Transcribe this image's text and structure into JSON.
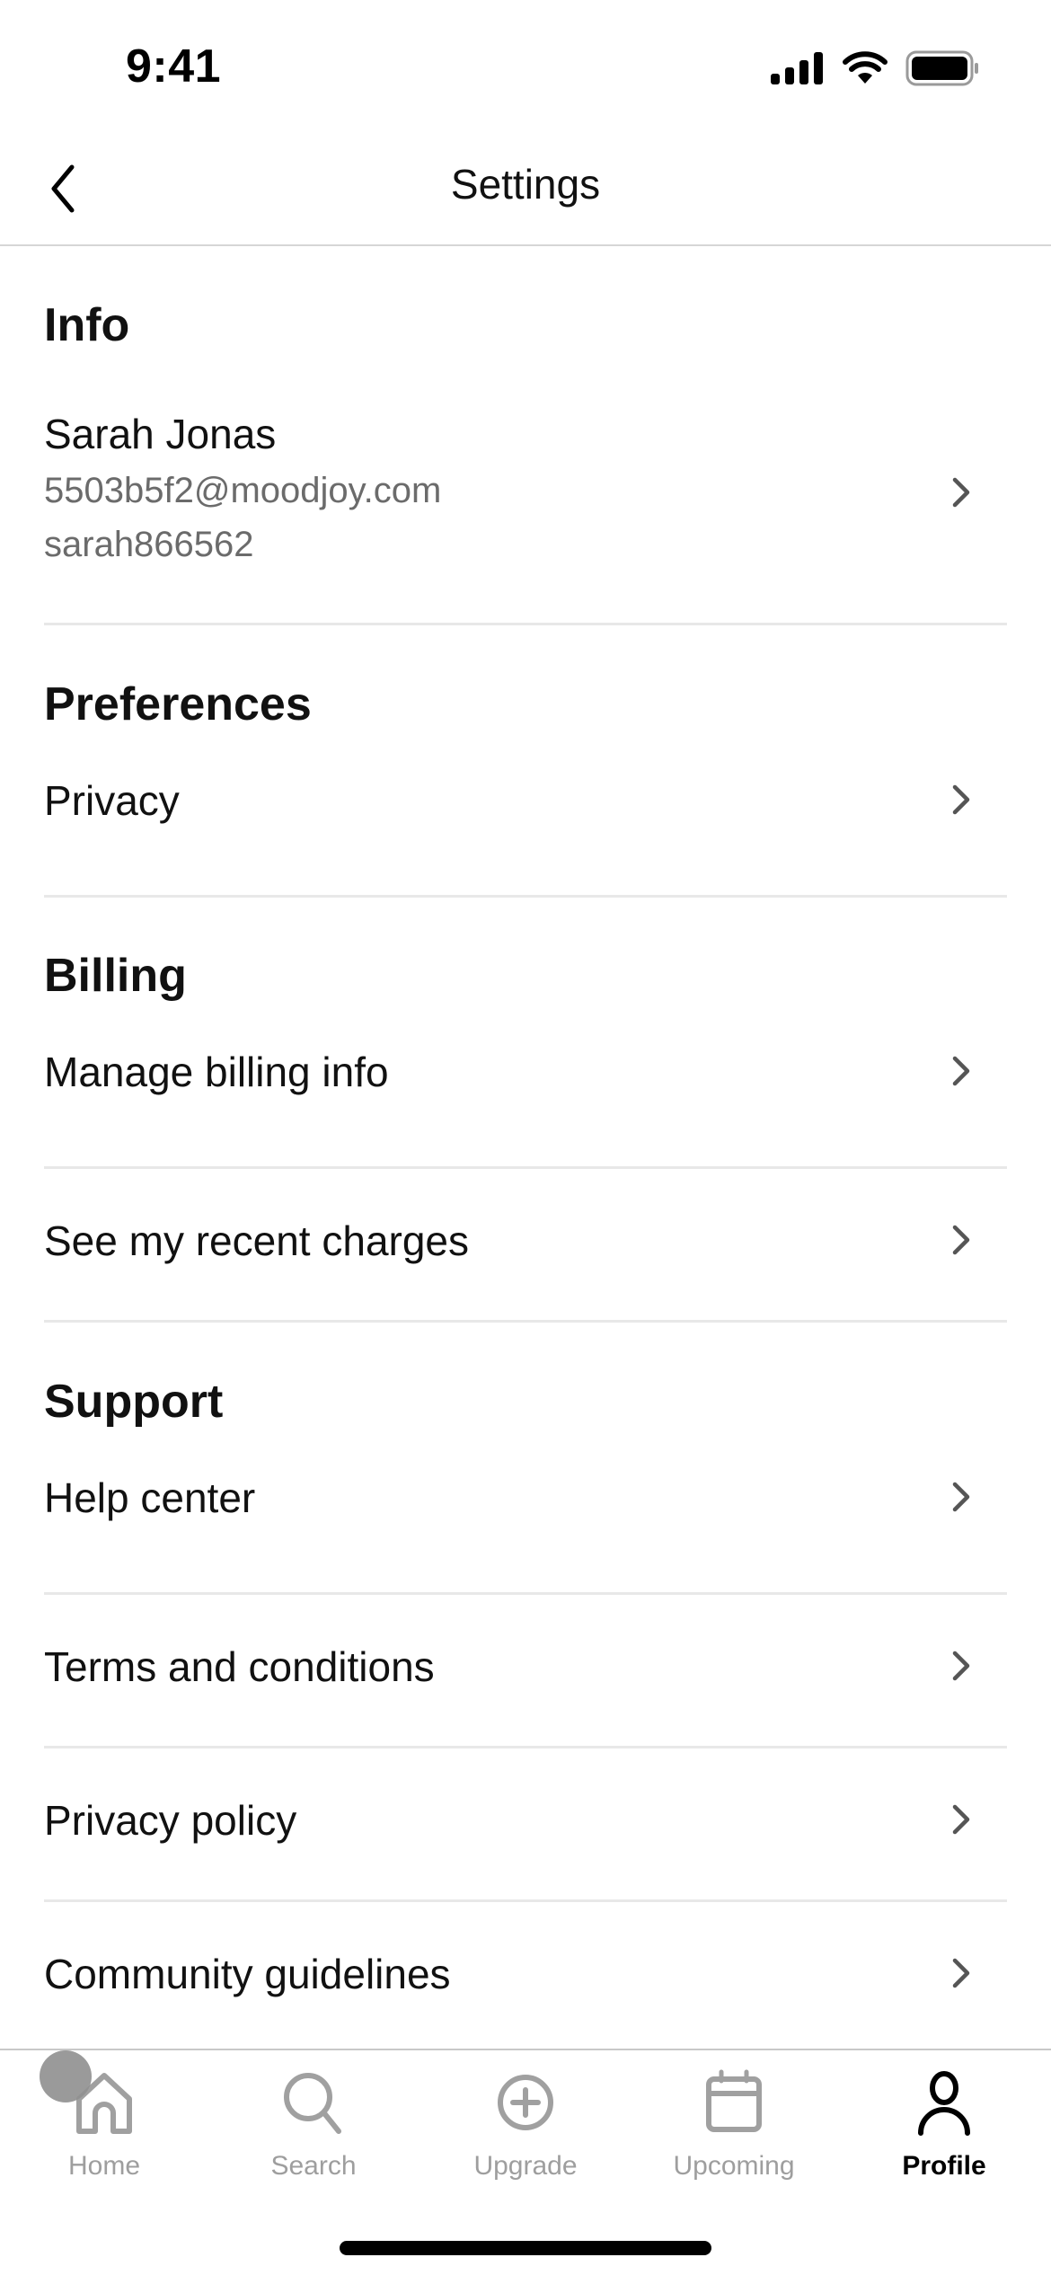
{
  "status_bar": {
    "time": "9:41"
  },
  "nav": {
    "title": "Settings",
    "back_icon": "chevron-left-icon"
  },
  "sections": {
    "info": {
      "title": "Info",
      "profile": {
        "name": "Sarah Jonas",
        "email": "5503b5f2@moodjoy.com",
        "username": "sarah866562"
      }
    },
    "preferences": {
      "title": "Preferences",
      "items": [
        {
          "label": "Privacy"
        }
      ]
    },
    "billing": {
      "title": "Billing",
      "items": [
        {
          "label": "Manage billing info"
        },
        {
          "label": "See my recent charges"
        }
      ]
    },
    "support": {
      "title": "Support",
      "items": [
        {
          "label": "Help center"
        },
        {
          "label": "Terms and conditions"
        },
        {
          "label": "Privacy policy"
        },
        {
          "label": "Community guidelines"
        }
      ]
    }
  },
  "tab_bar": {
    "tabs": [
      {
        "label": "Home",
        "icon": "home-icon",
        "active": false
      },
      {
        "label": "Search",
        "icon": "search-icon",
        "active": false
      },
      {
        "label": "Upgrade",
        "icon": "plus-circle-icon",
        "active": false
      },
      {
        "label": "Upcoming",
        "icon": "calendar-icon",
        "active": false
      },
      {
        "label": "Profile",
        "icon": "person-icon",
        "active": true
      }
    ]
  },
  "colors": {
    "text_primary": "#111111",
    "text_secondary": "#6b6b6b",
    "inactive_tab": "#9e9e9e",
    "divider": "#e8e8e8"
  }
}
